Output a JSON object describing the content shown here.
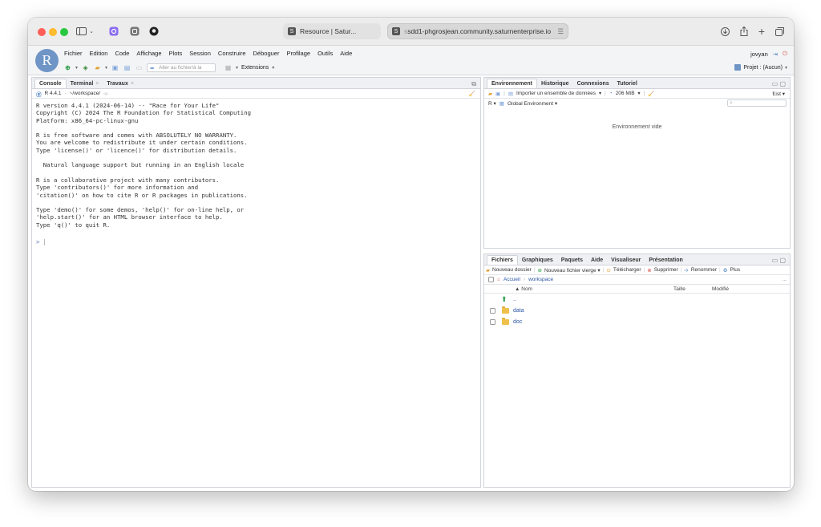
{
  "browser": {
    "tabs": [
      {
        "icon": "S",
        "title": "Resource | Satur..."
      },
      {
        "icon": "S",
        "url_prefix": "s",
        "url": "sdd1-phgrosjean.community.saturnenterprise.io"
      }
    ]
  },
  "rstudio": {
    "menu": [
      "Fichier",
      "Edition",
      "Code",
      "Affichage",
      "Plots",
      "Session",
      "Construire",
      "Déboguer",
      "Profilage",
      "Outils",
      "Aide"
    ],
    "user": "jovyan",
    "goto_placeholder": "Aller au fichier/à la",
    "extensions_label": "Extensions",
    "project_label": "Projet : (Aucun)"
  },
  "console_pane": {
    "tabs": [
      {
        "label": "Console",
        "closable": false
      },
      {
        "label": "Terminal",
        "closable": true
      },
      {
        "label": "Travaux",
        "closable": true
      }
    ],
    "version": "R 4.4.1",
    "path": "~/workspace/",
    "output": "R version 4.4.1 (2024-06-14) -- \"Race for Your Life\"\nCopyright (C) 2024 The R Foundation for Statistical Computing\nPlatform: x86_64-pc-linux-gnu\n\nR is free software and comes with ABSOLUTELY NO WARRANTY.\nYou are welcome to redistribute it under certain conditions.\nType 'license()' or 'licence()' for distribution details.\n\n  Natural language support but running in an English locale\n\nR is a collaborative project with many contributors.\nType 'contributors()' for more information and\n'citation()' on how to cite R or R packages in publications.\n\nType 'demo()' for some demos, 'help()' for on-line help, or\n'help.start()' for an HTML browser interface to help.\nType 'q()' to quit R.",
    "prompt": ">"
  },
  "env_pane": {
    "tabs": [
      "Environnement",
      "Historique",
      "Connexions",
      "Tutoriel"
    ],
    "import_label": "Importer un ensemble de données",
    "memory": "206 MiB",
    "view_mode": "List",
    "lang": "R",
    "scope": "Global Environment",
    "empty_message": "Environnement vide"
  },
  "files_pane": {
    "tabs": [
      "Fichiers",
      "Graphiques",
      "Paquets",
      "Aide",
      "Visualiseur",
      "Présentation"
    ],
    "actions": {
      "new_folder": "Nouveau dossier",
      "new_file": "Nouveau fichier vierge",
      "upload": "Télécharger",
      "delete": "Supprimer",
      "rename": "Renommer",
      "more": "Plus"
    },
    "breadcrumb": {
      "home": "Accueil",
      "current": "workspace"
    },
    "columns": {
      "name": "Nom",
      "size": "Taille",
      "modified": "Modifié"
    },
    "parent": "..",
    "more_crumb": "...",
    "files": [
      {
        "name": "data",
        "type": "folder"
      },
      {
        "name": "doc",
        "type": "folder"
      }
    ]
  },
  "colors": {
    "r_logo": "#6f95c6",
    "link": "#2a56a6",
    "folder": "#f0c04c"
  }
}
